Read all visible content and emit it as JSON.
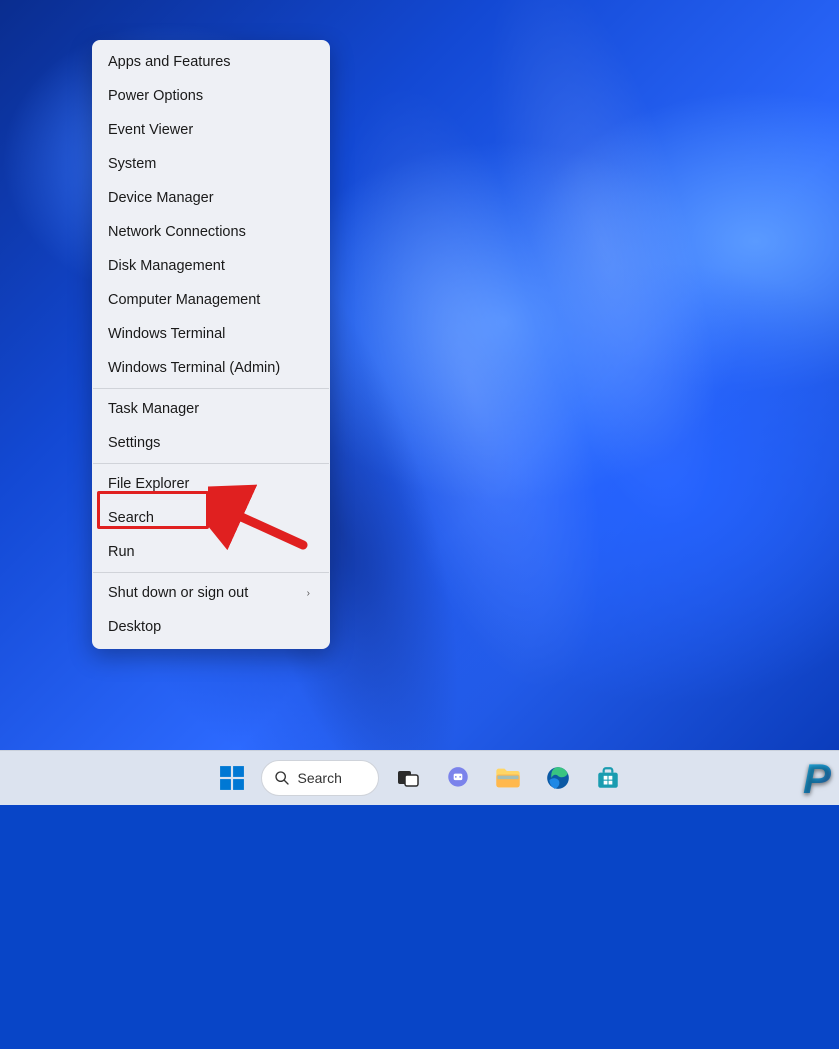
{
  "context_menu": {
    "items": [
      {
        "label": "Apps and Features",
        "submenu": false
      },
      {
        "label": "Power Options",
        "submenu": false
      },
      {
        "label": "Event Viewer",
        "submenu": false
      },
      {
        "label": "System",
        "submenu": false
      },
      {
        "label": "Device Manager",
        "submenu": false
      },
      {
        "label": "Network Connections",
        "submenu": false
      },
      {
        "label": "Disk Management",
        "submenu": false
      },
      {
        "label": "Computer Management",
        "submenu": false
      },
      {
        "label": "Windows Terminal",
        "submenu": false
      },
      {
        "label": "Windows Terminal (Admin)",
        "submenu": false
      },
      {
        "sep": true
      },
      {
        "label": "Task Manager",
        "submenu": false
      },
      {
        "label": "Settings",
        "submenu": false,
        "highlighted": true
      },
      {
        "sep": true
      },
      {
        "label": "File Explorer",
        "submenu": false
      },
      {
        "label": "Search",
        "submenu": false
      },
      {
        "label": "Run",
        "submenu": false
      },
      {
        "sep": true
      },
      {
        "label": "Shut down or sign out",
        "submenu": true
      },
      {
        "label": "Desktop",
        "submenu": false
      }
    ]
  },
  "taskbar": {
    "search_label": "Search"
  },
  "watermark": "P"
}
